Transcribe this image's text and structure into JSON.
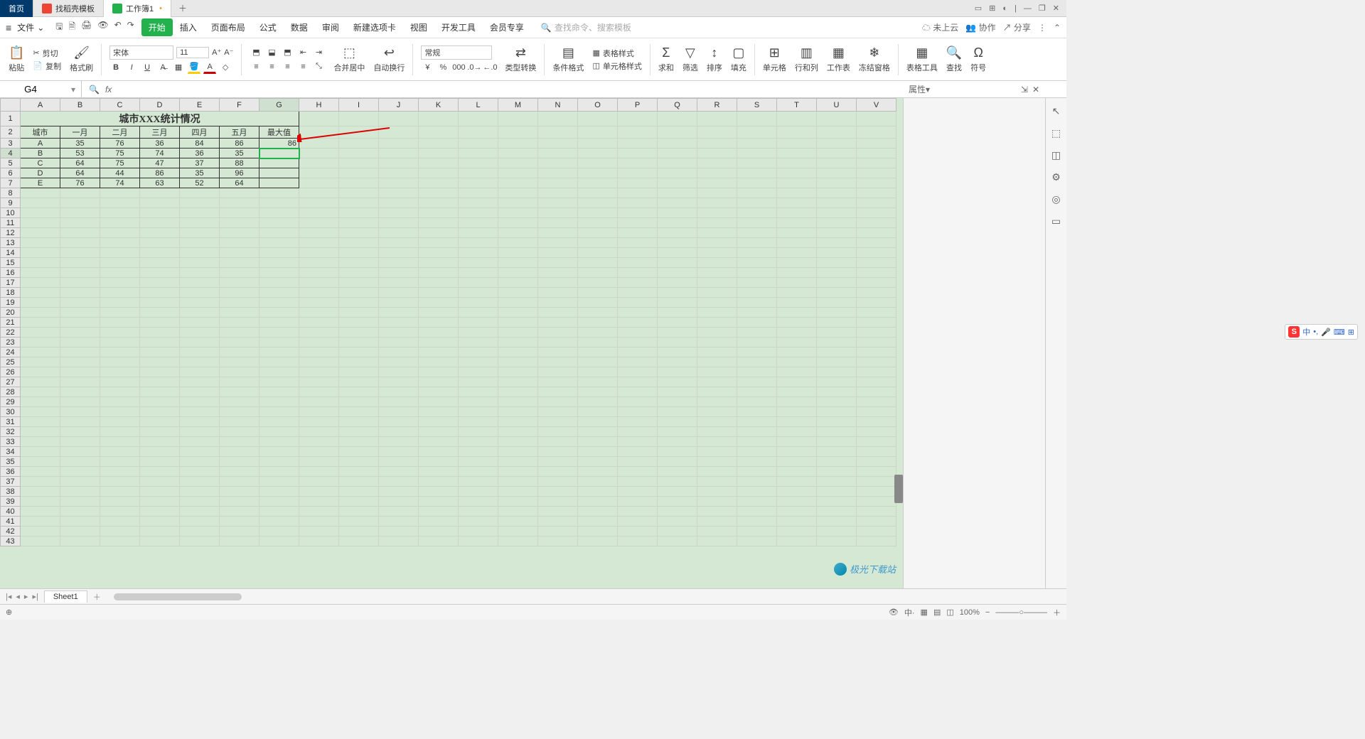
{
  "tabs": {
    "home": "首页",
    "template": "找稻壳模板",
    "workbook": "工作簿1"
  },
  "menu": {
    "file": "文件",
    "items": [
      "开始",
      "插入",
      "页面布局",
      "公式",
      "数据",
      "审阅",
      "新建选项卡",
      "视图",
      "开发工具",
      "会员专享"
    ],
    "search_ph": "查找命令、搜索模板",
    "cloud": "未上云",
    "coop": "协作",
    "share": "分享"
  },
  "ribbon": {
    "paste": "粘贴",
    "cut": "剪切",
    "copy": "复制",
    "fmt_painter": "格式刷",
    "font_name": "宋体",
    "font_size": "11",
    "merge": "合并居中",
    "wrap": "自动换行",
    "num_fmt": "常规",
    "type_conv": "类型转换",
    "cond_fmt": "条件格式",
    "table_style": "表格样式",
    "cell_style": "单元格样式",
    "sum": "求和",
    "filter": "筛选",
    "sort": "排序",
    "fill": "填充",
    "cell": "单元格",
    "rowcol": "行和列",
    "worksheet": "工作表",
    "freeze": "冻结窗格",
    "table_tool": "表格工具",
    "find": "查找",
    "symbol": "符号"
  },
  "namebox": "G4",
  "prop_label": "属性",
  "sheet": {
    "title": "城市XXX统计情况",
    "head": [
      "城市",
      "一月",
      "二月",
      "三月",
      "四月",
      "五月",
      "最大值"
    ],
    "rows": [
      [
        "A",
        "35",
        "76",
        "36",
        "84",
        "86",
        "86"
      ],
      [
        "B",
        "53",
        "75",
        "74",
        "36",
        "35",
        ""
      ],
      [
        "C",
        "64",
        "75",
        "47",
        "37",
        "88",
        ""
      ],
      [
        "D",
        "64",
        "44",
        "86",
        "35",
        "96",
        ""
      ],
      [
        "E",
        "76",
        "74",
        "63",
        "52",
        "64",
        ""
      ]
    ]
  },
  "sheet_tab": "Sheet1",
  "status": {
    "zoom": "100%"
  },
  "ime": {
    "lang": "中"
  },
  "watermark": "极光下载站"
}
